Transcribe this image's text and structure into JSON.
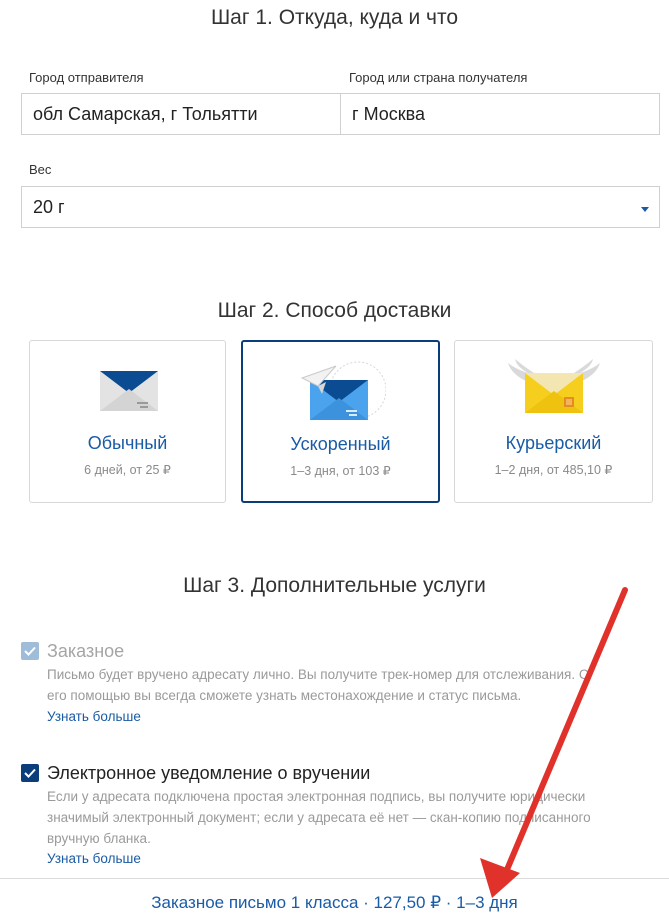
{
  "step1": {
    "title": "Шаг 1. Откуда, куда и что",
    "sender_label": "Город отправителя",
    "sender_value": "обл Самарская, г Тольятти",
    "recipient_label": "Город или страна получателя",
    "recipient_value": "г Москва",
    "weight_label": "Вес",
    "weight_value": "20 г"
  },
  "step2": {
    "title": "Шаг 2. Способ доставки",
    "options": [
      {
        "name": "Обычный",
        "details": "6 дней, от 25 ₽",
        "icon": "grey-envelope-icon",
        "selected": false
      },
      {
        "name": "Ускоренный",
        "details": "1–3 дня, от 103 ₽",
        "icon": "blue-envelope-paper-plane-icon",
        "selected": true
      },
      {
        "name": "Курьерский",
        "details": "1–2 дня, от 485,10 ₽",
        "icon": "yellow-winged-envelope-icon",
        "selected": false
      }
    ]
  },
  "step3": {
    "title": "Шаг 3. Дополнительные услуги",
    "services": [
      {
        "name": "Заказное",
        "checked": true,
        "disabled": true,
        "description_lines": [
          "Письмо будет вручено адресату лично. Вы получите трек-номер для отслеживания. С",
          "его помощью вы всегда сможете узнать местонахождение и статус письма."
        ],
        "link": "Узнать больше"
      },
      {
        "name": "Электронное уведомление о вручении",
        "checked": true,
        "disabled": false,
        "description_lines": [
          "Если у адресата подключена простая электронная подпись, вы получите юридически",
          "значимый электронный документ; если у адресата её нет — скан-копию подписанного",
          "вручную бланка."
        ],
        "link": "Узнать больше"
      }
    ]
  },
  "footer": {
    "summary": "Заказное письмо 1 класса · 127,50 ₽ · 1–3 дня"
  },
  "colors": {
    "accent": "#1a5ba6",
    "selected_border": "#0b3d7a",
    "annotation_arrow": "#e0322a"
  }
}
